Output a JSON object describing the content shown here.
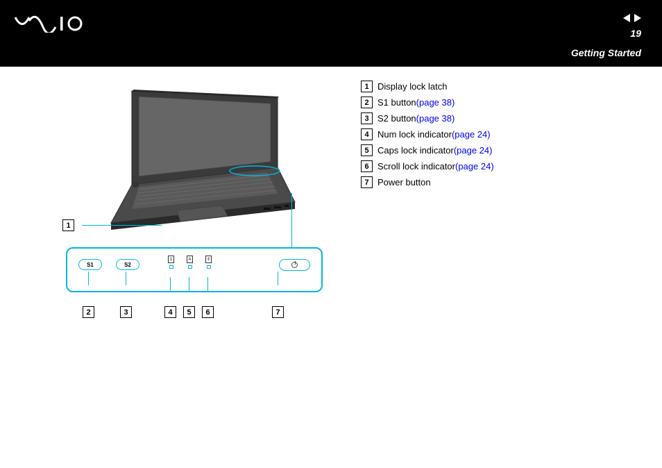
{
  "header": {
    "page_number": "19",
    "section_title": "Getting Started"
  },
  "legend": [
    {
      "num": "1",
      "label": "Display lock latch",
      "link": null
    },
    {
      "num": "2",
      "label": "S1 button ",
      "link": "(page 38)"
    },
    {
      "num": "3",
      "label": "S2 button ",
      "link": "(page 38)"
    },
    {
      "num": "4",
      "label": "Num lock indicator ",
      "link": "(page 24)"
    },
    {
      "num": "5",
      "label": "Caps lock indicator ",
      "link": "(page 24)"
    },
    {
      "num": "6",
      "label": "Scroll lock indicator ",
      "link": "(page 24)"
    },
    {
      "num": "7",
      "label": "Power button",
      "link": null
    }
  ],
  "detail": {
    "s1_label": "S1",
    "s2_label": "S2",
    "ind_1": "1",
    "ind_A": "A",
    "ind_scroll": "⇕"
  },
  "callouts": {
    "c1": "1",
    "c2": "2",
    "c3": "3",
    "c4": "4",
    "c5": "5",
    "c6": "6",
    "c7": "7"
  }
}
